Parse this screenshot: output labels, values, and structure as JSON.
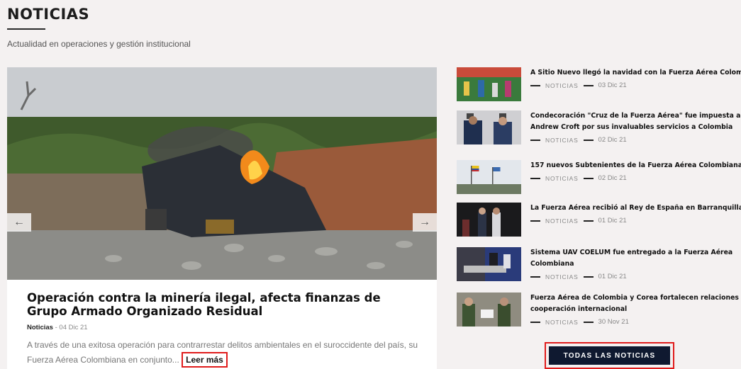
{
  "header": {
    "title": "NOTICIAS",
    "subtitle": "Actualidad en operaciones y gestión institucional"
  },
  "featured": {
    "title": "Operación contra la minería ilegal, afecta finanzas de Grupo Armado Organizado Residual",
    "category": "Noticias",
    "date_sep": " - ",
    "date": "04 Dic 21",
    "excerpt": "A través de una exitosa operación para contrarrestar delitos ambientales en el suroccidente del país, su Fuerza Aérea Colombiana en conjunto...",
    "read_more": "Leer más",
    "prev_arrow": "←",
    "next_arrow": "→"
  },
  "side_news": [
    {
      "title_lines": [
        "A Sitio Nuevo llegó la navidad con la Fuerza Aérea Colombiana"
      ],
      "category": "NOTICIAS",
      "date": "03 Dic 21"
    },
    {
      "title_lines": [
        "Condecoración \"Cruz de la Fuerza Aérea\" fue impuesta al General",
        "Andrew Croft por sus invaluables servicios a Colombia"
      ],
      "category": "NOTICIAS",
      "date": "02 Dic 21"
    },
    {
      "title_lines": [
        "157 nuevos Subtenientes de la Fuerza Aérea Colombiana"
      ],
      "category": "NOTICIAS",
      "date": "02 Dic 21"
    },
    {
      "title_lines": [
        "La Fuerza Aérea recibió al Rey de España en Barranquilla"
      ],
      "category": "NOTICIAS",
      "date": "01 Dic 21"
    },
    {
      "title_lines": [
        "Sistema UAV COELUM fue entregado a la Fuerza Aérea",
        "Colombiana"
      ],
      "category": "NOTICIAS",
      "date": "01 Dic 21"
    },
    {
      "title_lines": [
        "Fuerza Aérea de Colombia y Corea fortalecen relaciones de",
        "cooperación internacional"
      ],
      "category": "NOTICIAS",
      "date": "30 Nov 21"
    }
  ],
  "all_news_label": "TODAS LAS NOTICIAS",
  "colors": {
    "highlight_border": "#e01c1c",
    "button_bg": "#0f1930",
    "page_bg": "#f4f1f1"
  }
}
